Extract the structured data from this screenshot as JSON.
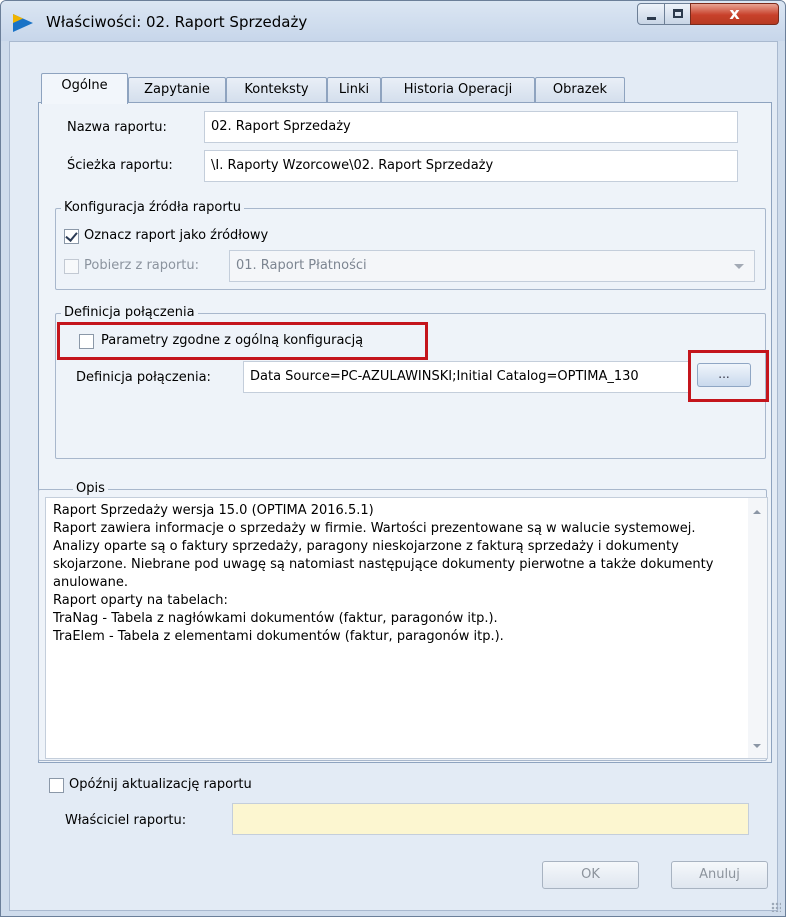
{
  "window": {
    "title": "Właściwości: 02. Raport Sprzedaży",
    "close_glyph": "x",
    "accent": "#1a73c6"
  },
  "tabs": [
    {
      "label": "Ogólne",
      "active": true
    },
    {
      "label": "Zapytanie",
      "active": false
    },
    {
      "label": "Konteksty",
      "active": false
    },
    {
      "label": "Linki",
      "active": false
    },
    {
      "label": "Historia Operacji",
      "active": false
    },
    {
      "label": "Obrazek",
      "active": false
    }
  ],
  "general": {
    "report_name_label": "Nazwa raportu:",
    "report_name_value": "02. Raport Sprzedaży",
    "report_path_label": "Ścieżka raportu:",
    "report_path_value": "\\I. Raporty Wzorcowe\\02. Raport Sprzedaży"
  },
  "source_config": {
    "group_title": "Konfiguracja źródła raportu",
    "mark_source_label": "Oznacz raport jako źródłowy",
    "mark_source_checked": true,
    "fetch_from_label": "Pobierz z raportu:",
    "fetch_from_checked": false,
    "fetch_from_value": "01. Raport Płatności"
  },
  "connection": {
    "group_title": "Definicja połączenia",
    "params_label": "Parametry zgodne z ogólną konfiguracją",
    "params_checked": false,
    "definition_label": "Definicja połączenia:",
    "definition_value": "Data Source=PC-AZULAWINSKI;Initial Catalog=OPTIMA_130",
    "ellipsis_label": "..."
  },
  "description": {
    "group_title": "Opis",
    "lines": [
      "Raport Sprzedaży wersja 15.0 (OPTIMA 2016.5.1)",
      "",
      "Raport zawiera informacje o sprzedaży w firmie. Wartości prezentowane są w walucie systemowej.",
      "",
      "Analizy oparte są o faktury sprzedaży, paragony nieskojarzone z fakturą sprzedaży i dokumenty",
      "skojarzone. Niebrane pod uwagę są natomiast następujące dokumenty pierwotne a także dokumenty anulowane.",
      "",
      "Raport oparty na tabelach:",
      "TraNag - Tabela z nagłówkami dokumentów (faktur, paragonów itp.).",
      "TraElem - Tabela z elementami dokumentów (faktur, paragonów itp.)."
    ]
  },
  "footer": {
    "delay_update_label": "Opóźnij aktualizację raportu",
    "delay_update_checked": false,
    "owner_label": "Właściciel raportu:",
    "owner_value": "",
    "ok_label": "OK",
    "cancel_label": "Anuluj"
  },
  "highlight_color": "#c4151c"
}
